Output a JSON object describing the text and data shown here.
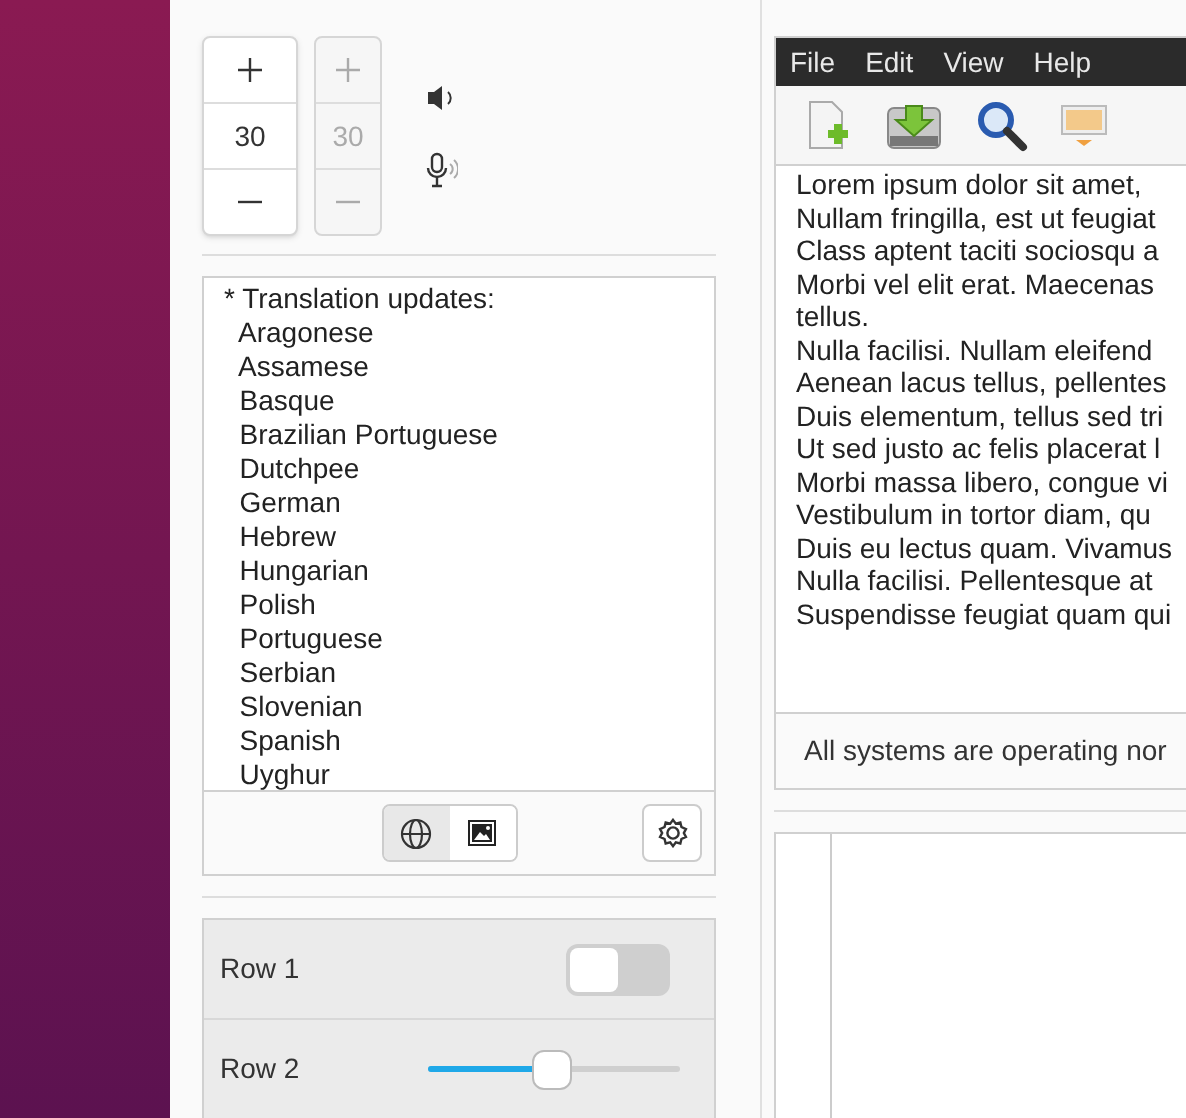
{
  "spinners": [
    {
      "value": "30",
      "disabled": false
    },
    {
      "value": "30",
      "disabled": true
    }
  ],
  "translation_view": {
    "lines": [
      "* Translation updates:",
      "  Aragonese",
      "  Assamese",
      "  Basque",
      "  Brazilian Portuguese",
      "  Dutchpee",
      "  German",
      "  Hebrew",
      "  Hungarian",
      "  Polish",
      "  Portuguese",
      "  Serbian",
      "  Slovenian",
      "  Spanish",
      "  Uyghur"
    ]
  },
  "view_toggle": [
    {
      "kind": "globe",
      "selected": true
    },
    {
      "kind": "image",
      "selected": false
    }
  ],
  "rows": [
    {
      "kind": "switch",
      "label": "Row 1",
      "on": false
    },
    {
      "kind": "slider",
      "label": "Row 2",
      "level": 0.49
    }
  ],
  "editor": {
    "menu": [
      "File",
      "Edit",
      "View",
      "Help"
    ],
    "lines": [
      "Lorem ipsum dolor sit amet,",
      "Nullam fringilla, est ut feugiat",
      "Class aptent taciti sociosqu a",
      "Morbi vel elit erat. Maecenas",
      "tellus.",
      "Nulla facilisi. Nullam eleifend",
      "Aenean lacus tellus, pellentes",
      "Duis elementum, tellus sed tri",
      "Ut sed justo ac felis placerat l",
      "Morbi massa libero, congue vi",
      "Vestibulum in tortor diam, qu",
      "Duis eu lectus quam. Vivamus",
      "Nulla facilisi. Pellentesque at",
      "Suspendisse feugiat quam qui"
    ],
    "status": "All systems are operating nor"
  }
}
